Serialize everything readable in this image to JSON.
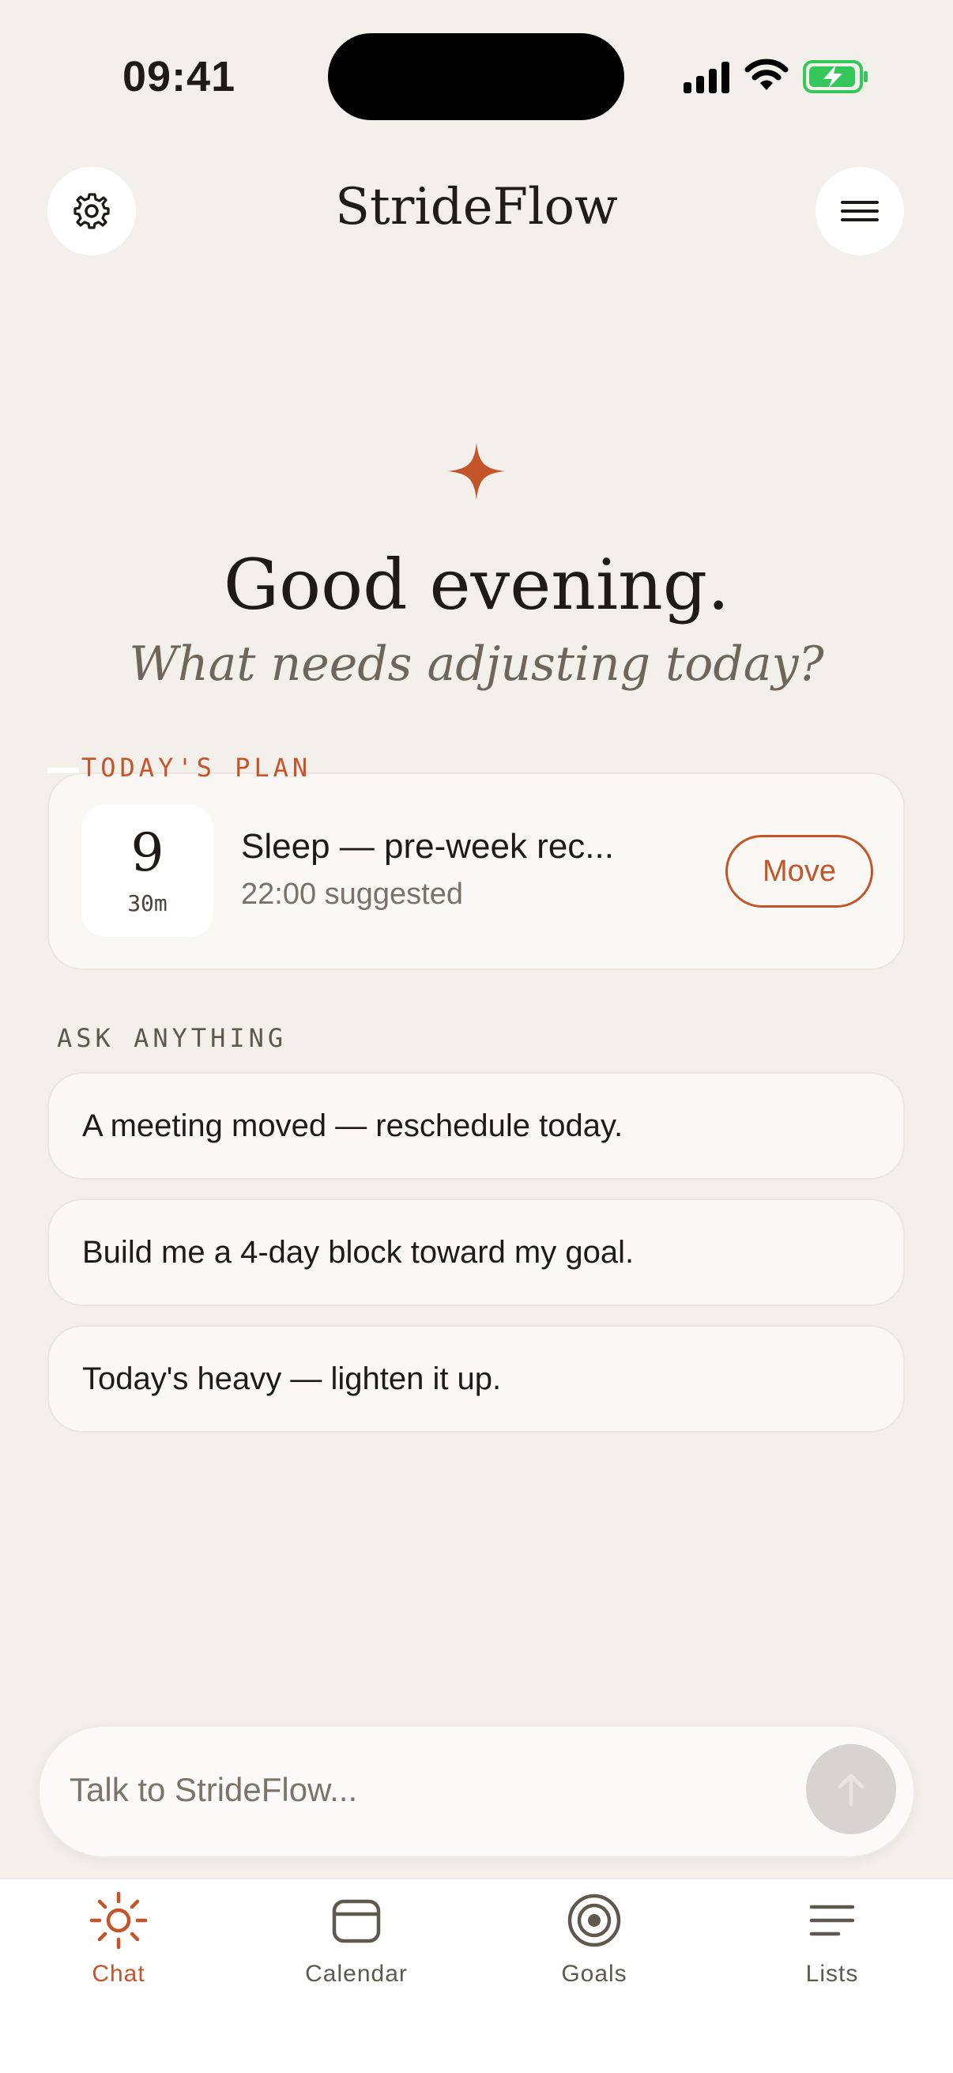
{
  "status_bar": {
    "time": "09:41"
  },
  "header": {
    "app_title": "StrideFlow"
  },
  "hero": {
    "greeting": "Good evening.",
    "subtitle": "What needs adjusting today?"
  },
  "todays_plan": {
    "section_label": "TODAY'S PLAN",
    "item": {
      "day": "9",
      "duration": "30m",
      "title": "Sleep — pre-week rec...",
      "subtitle": "22:00 suggested",
      "action_label": "Move"
    }
  },
  "ask_anything": {
    "section_label": "ASK ANYTHING",
    "prompts": [
      "A meeting moved — reschedule today.",
      "Build me a 4-day block toward my goal.",
      "Today's heavy — lighten it up."
    ]
  },
  "chat_input": {
    "placeholder": "Talk to StrideFlow..."
  },
  "tabs": [
    {
      "label": "Chat",
      "icon": "sun-icon",
      "active": true
    },
    {
      "label": "Calendar",
      "icon": "calendar-icon",
      "active": false
    },
    {
      "label": "Goals",
      "icon": "target-icon",
      "active": false
    },
    {
      "label": "Lists",
      "icon": "lines-icon",
      "active": false
    }
  ],
  "colors": {
    "accent": "#c4542a",
    "background": "#f3f0eb",
    "card": "#faf8f4",
    "battery": "#34c759"
  }
}
